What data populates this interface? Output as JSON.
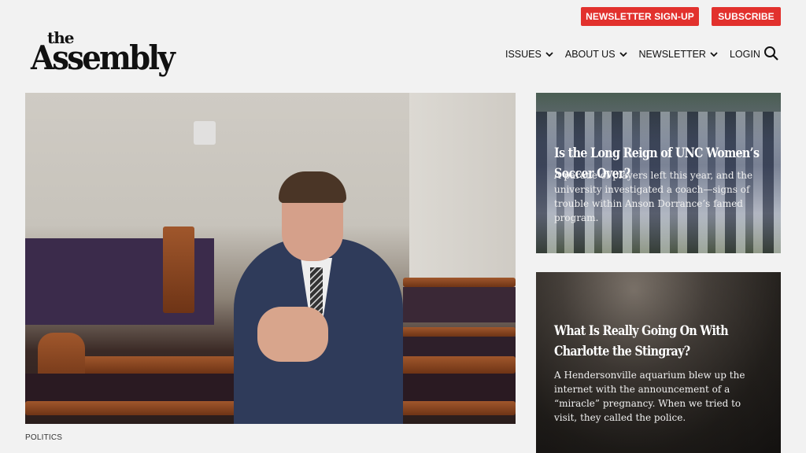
{
  "header": {
    "newsletter_btn": "NEWSLETTER SIGN-UP",
    "subscribe_btn": "SUBSCRIBE",
    "logo_small": "the",
    "logo_main": "Assembly",
    "nav": [
      {
        "label": "ISSUES"
      },
      {
        "label": "ABOUT US"
      },
      {
        "label": "NEWSLETTER"
      },
      {
        "label": "LOGIN"
      }
    ],
    "search_icon": "search-icon",
    "accent_color": "#e2312d"
  },
  "hero": {
    "category": "POLITICS"
  },
  "stories": [
    {
      "title": "Is the Long Reign of UNC Women’s Soccer Over?",
      "desc": "A parade of players left this year, and the university investigated a coach—signs of trouble within Anson Dorrance’s famed program."
    },
    {
      "title": "What Is Really Going On With Charlotte the Stingray?",
      "desc": "A Hendersonville aquarium blew up the internet with the announcement of a “miracle” pregnancy. When we tried to visit, they called the police."
    }
  ]
}
